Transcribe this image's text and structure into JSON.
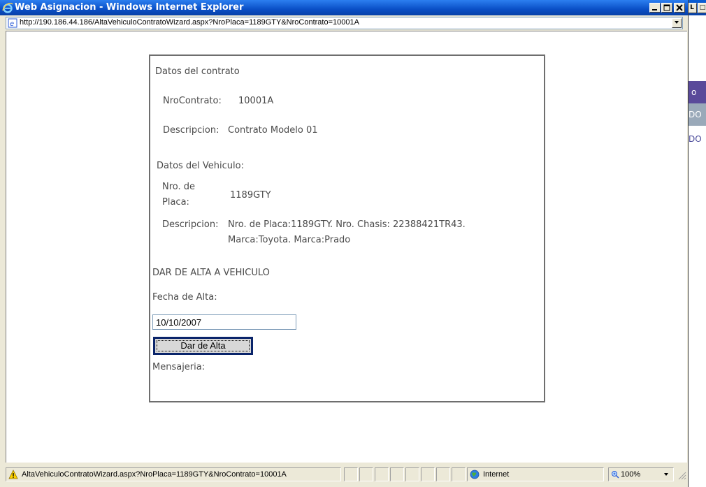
{
  "window": {
    "title": "Web Asignacion - Windows Internet Explorer",
    "address": "http://190.186.44.186/AltaVehiculoContratoWizard.aspx?NroPlaca=1189GTY&NroContrato=10001A"
  },
  "bg_window": {
    "row1": "o",
    "row2": "DO",
    "row3": "DO"
  },
  "contrato": {
    "heading": "Datos del contrato",
    "nro_label": "NroContrato:",
    "nro_value": "10001A",
    "desc_label": "Descripcion:",
    "desc_value": "Contrato Modelo 01"
  },
  "vehiculo": {
    "heading": "Datos del Vehiculo:",
    "placa_label_1": "Nro. de",
    "placa_label_2": "Placa:",
    "placa_value": "1189GTY",
    "desc_label": "Descripcion:",
    "desc_value_1": "Nro. de Placa:1189GTY. Nro. Chasis: 22388421TR43.",
    "desc_value_2": "Marca:Toyota. Marca:Prado"
  },
  "alta": {
    "heading": "DAR DE ALTA A VEHICULO",
    "fecha_label": "Fecha de Alta:",
    "fecha_value": "10/10/2007",
    "button_label": "Dar de Alta",
    "mensajeria_label": "Mensajeria:"
  },
  "status": {
    "text": "AltaVehiculoContratoWizard.aspx?NroPlaca=1189GTY&NroContrato=10001A",
    "zone": "Internet",
    "zoom": "100%"
  },
  "icons": [
    "ie-logo-icon",
    "page-icon",
    "warning-icon",
    "globe-icon",
    "zoom-icon"
  ]
}
